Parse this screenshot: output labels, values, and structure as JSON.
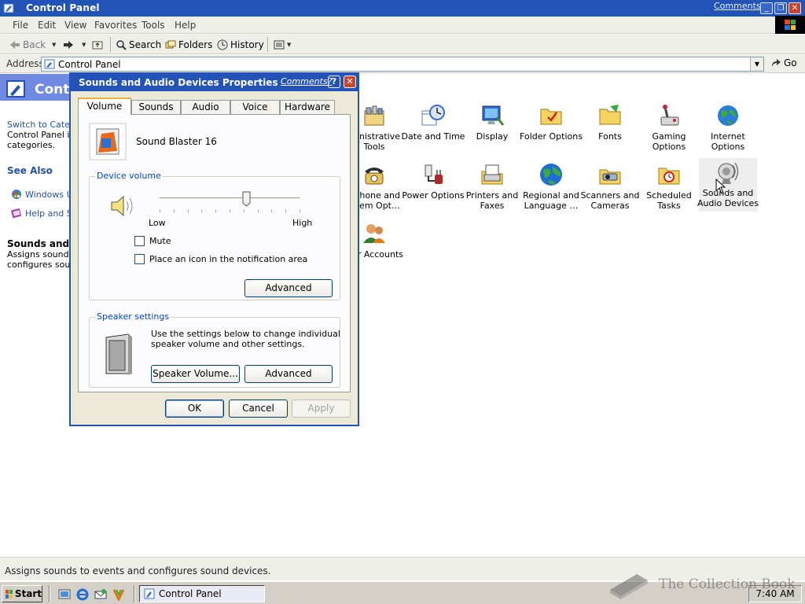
{
  "window": {
    "title": "Control Panel",
    "comments_link": "Comments?",
    "controls": {
      "minimize": "_",
      "maximize": "❐",
      "close": "✕"
    }
  },
  "menu": [
    "File",
    "Edit",
    "View",
    "Favorites",
    "Tools",
    "Help"
  ],
  "toolbar": {
    "back": "Back",
    "search": "Search",
    "folders": "Folders",
    "history": "History"
  },
  "address": {
    "label": "Address",
    "value": "Control Panel",
    "go": "Go"
  },
  "taskpane": {
    "title": "Control Panel",
    "switch_link": "Switch to Category View",
    "description_lines": [
      "Control Panel icons",
      "categories."
    ],
    "see_also": "See Also",
    "links": [
      "Windows Update",
      "Help and Support"
    ],
    "selected_title": "Sounds and Audio Devices",
    "selected_desc_lines": [
      "Assigns sounds to",
      "configures sound"
    ]
  },
  "items": [
    {
      "label": "Administrative Tools",
      "label_lines": [
        "ministrative",
        "Tools"
      ],
      "icon": "admin-tools-icon"
    },
    {
      "label": "Date and Time",
      "label_lines": [
        "Date and Time"
      ],
      "icon": "clock-icon"
    },
    {
      "label": "Display",
      "label_lines": [
        "Display"
      ],
      "icon": "display-icon"
    },
    {
      "label": "Folder Options",
      "label_lines": [
        "Folder Options"
      ],
      "icon": "folder-options-icon"
    },
    {
      "label": "Fonts",
      "label_lines": [
        "Fonts"
      ],
      "icon": "fonts-icon"
    },
    {
      "label": "Gaming Options",
      "label_lines": [
        "Gaming",
        "Options"
      ],
      "icon": "joystick-icon"
    },
    {
      "label": "Internet Options",
      "label_lines": [
        "Internet",
        "Options"
      ],
      "icon": "globe-icon"
    },
    {
      "label": "Phone and Modem Options",
      "label_lines": [
        "hone and",
        "dem Opt…"
      ],
      "icon": "phone-icon"
    },
    {
      "label": "Power Options",
      "label_lines": [
        "Power Options"
      ],
      "icon": "power-icon"
    },
    {
      "label": "Printers and Faxes",
      "label_lines": [
        "Printers and",
        "Faxes"
      ],
      "icon": "printer-icon"
    },
    {
      "label": "Regional and Language Options",
      "label_lines": [
        "Regional and",
        "Language …"
      ],
      "icon": "world-icon"
    },
    {
      "label": "Scanners and Cameras",
      "label_lines": [
        "Scanners and",
        "Cameras"
      ],
      "icon": "scanner-icon"
    },
    {
      "label": "Scheduled Tasks",
      "label_lines": [
        "Scheduled",
        "Tasks"
      ],
      "icon": "scheduled-tasks-icon"
    },
    {
      "label": "Sounds and Audio Devices",
      "label_lines": [
        "Sounds and",
        "Audio Devices"
      ],
      "icon": "speaker-icon",
      "selected": true
    },
    {
      "label": "User Accounts",
      "label_lines": [
        "er Accounts"
      ],
      "icon": "users-icon"
    }
  ],
  "dialog": {
    "title": "Sounds and Audio Devices Properties",
    "comments_link": "Comments?",
    "help": "?",
    "close": "✕",
    "tabs": [
      "Volume",
      "Sounds",
      "Audio",
      "Voice",
      "Hardware"
    ],
    "active_tab": "Volume",
    "device_name": "Sound Blaster 16",
    "device_volume": {
      "legend": "Device volume",
      "low": "Low",
      "high": "High",
      "level": 0.62
    },
    "mute": {
      "label": "Mute",
      "checked": false
    },
    "notify_icon": {
      "label": "Place an icon in the notification area",
      "checked": false
    },
    "advanced_1": "Advanced",
    "speaker": {
      "legend": "Speaker settings",
      "desc_line1": "Use the settings below to change individual",
      "desc_line2": "speaker volume and other settings.",
      "volume_btn": "Speaker Volume...",
      "advanced_btn": "Advanced"
    },
    "ok": "OK",
    "cancel": "Cancel",
    "apply": "Apply"
  },
  "status_text": "Assigns sounds to events and configures sound devices.",
  "taskbar": {
    "start": "Start",
    "task": "Control Panel",
    "clock": "7:40 AM"
  },
  "watermark": "The Collection Book"
}
